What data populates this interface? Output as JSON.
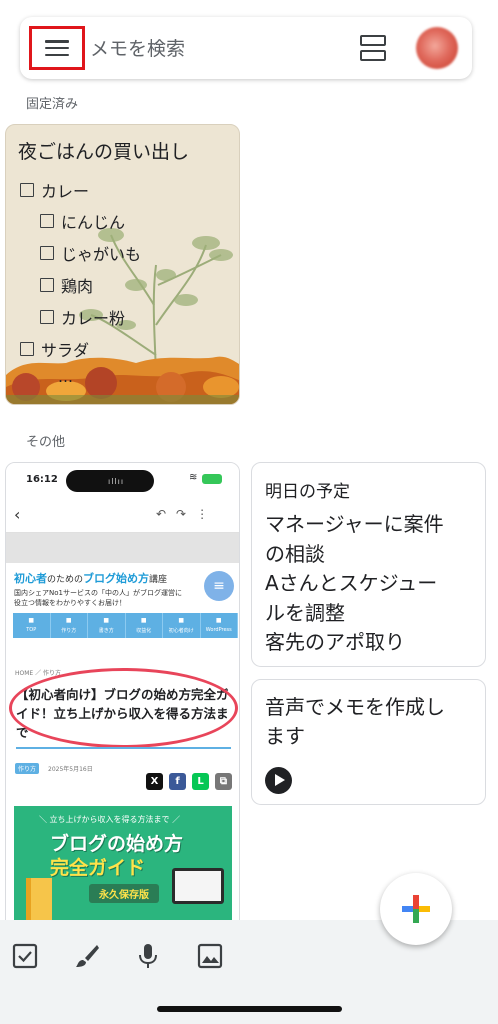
{
  "search": {
    "placeholder": "メモを検索"
  },
  "sections": {
    "pinned": "固定済み",
    "others": "その他"
  },
  "pinned_note": {
    "title": "夜ごはんの買い出し",
    "items": [
      {
        "text": "カレー",
        "checked": false,
        "indent": 0
      },
      {
        "text": "にんじん",
        "checked": false,
        "indent": 1
      },
      {
        "text": "じゃがいも",
        "checked": false,
        "indent": 1
      },
      {
        "text": "鶏肉",
        "checked": false,
        "indent": 1
      },
      {
        "text": "カレー粉",
        "checked": false,
        "indent": 1
      },
      {
        "text": "サラダ",
        "checked": false,
        "indent": 0
      }
    ],
    "more": "…"
  },
  "screenshot_note": {
    "status_time": "16:12",
    "blog_name_a": "初心者",
    "blog_name_b": "のための",
    "blog_name_c": "ブログ始め方",
    "blog_name_d": "講座",
    "blog_subtitle_1": "国内シェアNo1サービスの「中の人」がブログ運営に",
    "blog_subtitle_2": "役立つ情報をわかりやすくお届け！",
    "tabs": [
      "TOP",
      "作り方",
      "書き方",
      "収益化",
      "初心者向け",
      "WordPress"
    ],
    "breadcrumb": "HOME ／ 作り方",
    "article_title": "【初心者向け】ブログの始め方完全ガイド！立ち上げから収入を得る方法まで",
    "tag": "作り方",
    "date": "2025年5月16日",
    "hero_top": "＼ 立ち上げから収入を得る方法まで ／",
    "hero_title_1": "ブログの始め方",
    "hero_title_2": "完全ガイド",
    "hero_badge": "永久保存版"
  },
  "note_schedule": {
    "title": "明日の予定",
    "body": [
      "マネージャーに案件",
      "の相談",
      "Aさんとスケジュー",
      "ルを調整",
      "客先のアポ取り"
    ]
  },
  "note_voice": {
    "body": [
      "音声でメモを作成し",
      "ます"
    ]
  },
  "bottom_bar": {
    "icons": [
      "checkbox-icon",
      "brush-icon",
      "microphone-icon",
      "image-icon"
    ]
  },
  "colors": {
    "menu_highlight": "#e0161b",
    "pinned_bg": "#ede5d3",
    "fab_red": "#ea4335",
    "fab_green": "#34a853",
    "fab_blue": "#4285f4",
    "fab_yellow": "#fbbc05"
  }
}
